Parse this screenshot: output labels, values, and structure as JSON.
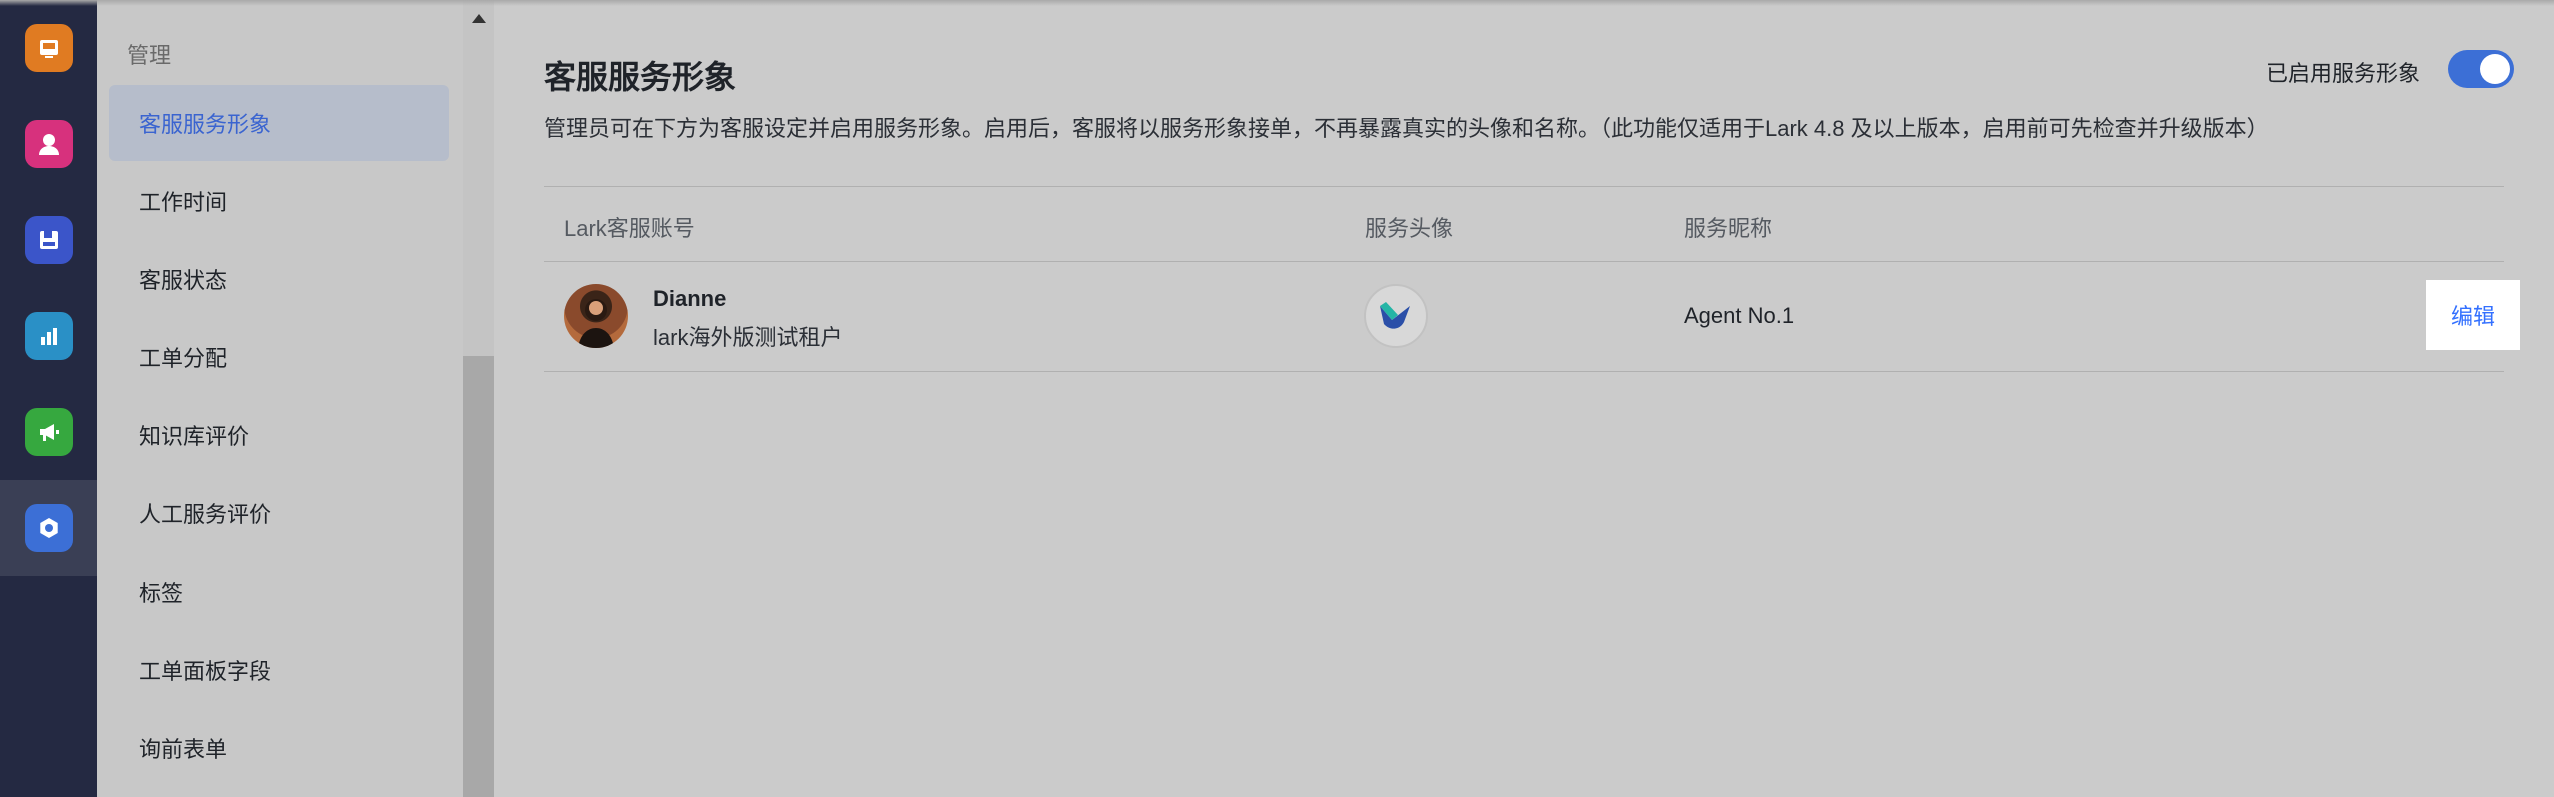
{
  "rail": {
    "items": [
      {
        "icon": "inbox-icon",
        "color": "#e07b22"
      },
      {
        "icon": "user-icon",
        "color": "#d7317d"
      },
      {
        "icon": "save-icon",
        "color": "#3b55c9"
      },
      {
        "icon": "bar-chart-icon",
        "color": "#2a90c6"
      },
      {
        "icon": "megaphone-icon",
        "color": "#36a83f"
      },
      {
        "icon": "gear-icon",
        "color": "#3c6fd6"
      }
    ],
    "active_index": 5
  },
  "subnav": {
    "heading": "管理",
    "items": [
      {
        "label": "客服服务形象",
        "active": true
      },
      {
        "label": "工作时间"
      },
      {
        "label": "客服状态"
      },
      {
        "label": "工单分配"
      },
      {
        "label": "知识库评价"
      },
      {
        "label": "人工服务评价"
      },
      {
        "label": "标签"
      },
      {
        "label": "工单面板字段"
      },
      {
        "label": "询前表单"
      }
    ]
  },
  "main": {
    "title": "客服服务形象",
    "description": "管理员可在下方为客服设定并启用服务形象。启用后，客服将以服务形象接单，不再暴露真实的头像和名称。（此功能仅适用于Lark 4.8 及以上版本，启用前可先检查并升级版本）",
    "toggle_label": "已启用服务形象",
    "toggle_on": true,
    "table": {
      "headers": [
        "Lark客服账号",
        "服务头像",
        "服务昵称"
      ],
      "rows": [
        {
          "name": "Dianne",
          "tenant": "lark海外版测试租户",
          "nickname": "Agent No.1",
          "action": "编辑"
        }
      ]
    }
  },
  "colors": {
    "accent": "#3370ff",
    "toggle": "#3c6fd6",
    "rail_bg": "#242942"
  }
}
